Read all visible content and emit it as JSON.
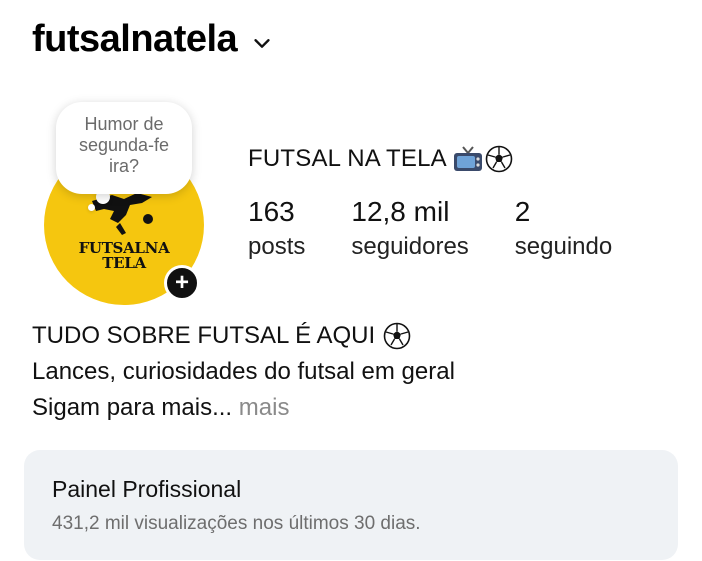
{
  "header": {
    "username": "futsalnatela",
    "dropdown_icon": "chevron-down-icon"
  },
  "note": {
    "text": "Humor de segunda-feira?",
    "lines": [
      "Humor de",
      "segunda-fe",
      "ira?"
    ]
  },
  "avatar": {
    "logo_line1": "FUTSALNA",
    "logo_line2": "TELA",
    "background": "#f5c60f",
    "add_icon": "plus-icon",
    "add_label": "+"
  },
  "profile": {
    "display_name": "FUTSAL NA TELA",
    "emoji_icons": [
      "tv-icon",
      "soccer-ball-icon"
    ]
  },
  "stats": [
    {
      "value": "163",
      "label": "posts"
    },
    {
      "value": "12,8 mil",
      "label": "seguidores"
    },
    {
      "value": "2",
      "label": "seguindo"
    }
  ],
  "bio": {
    "line1": "TUDO SOBRE FUTSAL É AQUI",
    "line2": "Lances, curiosidades do futsal em geral",
    "line3": "Sigam para mais",
    "ellipsis": "...",
    "more": "mais"
  },
  "panel": {
    "title": "Painel Profissional",
    "subtitle": "431,2 mil visualizações nos últimos 30 dias."
  }
}
